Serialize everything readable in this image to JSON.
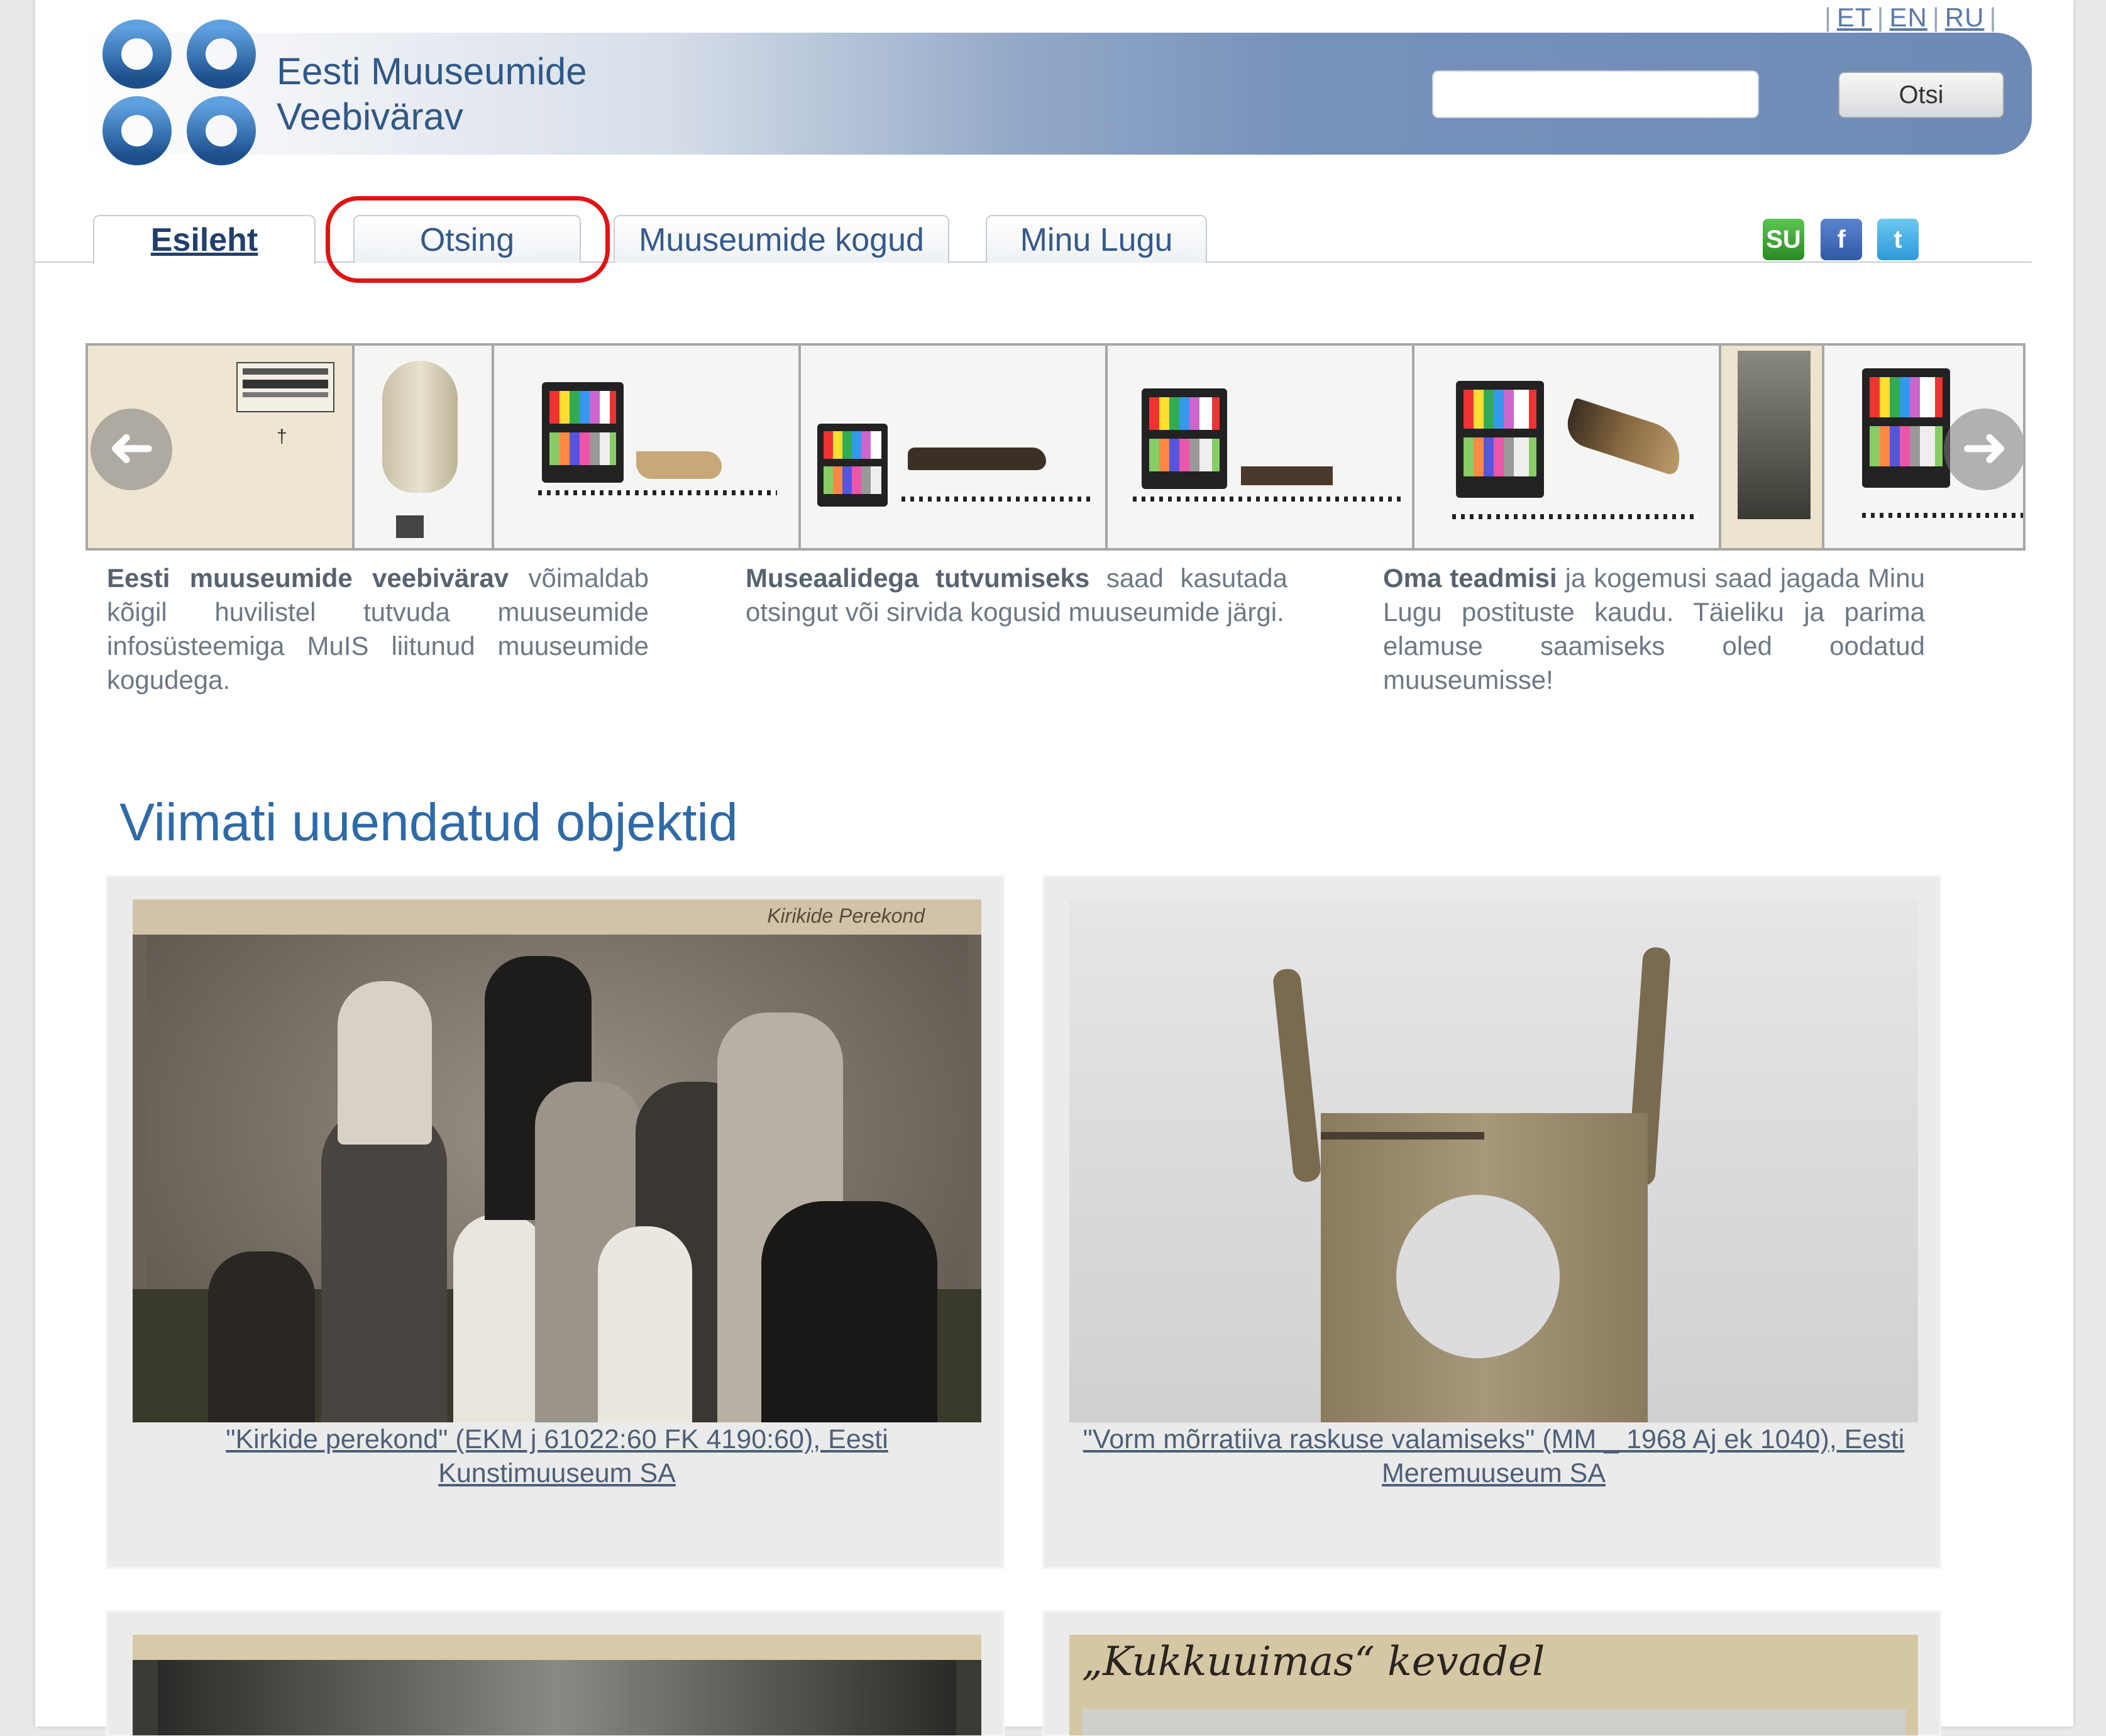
{
  "language_bar": {
    "items": [
      "ET",
      "EN",
      "RU"
    ]
  },
  "header": {
    "site_name_line1": "Eesti Muuseumide",
    "site_name_line2": "Veebivärav",
    "search": {
      "placeholder": "",
      "value": "",
      "button_label": "Otsi"
    }
  },
  "tabs": [
    {
      "label": "Esileht",
      "active": true
    },
    {
      "label": "Otsing",
      "active": false
    },
    {
      "label": "Muuseumide kogud",
      "active": false
    },
    {
      "label": "Minu Lugu",
      "active": false
    }
  ],
  "social": {
    "stumbleupon": "SU",
    "facebook": "f",
    "twitter": "t"
  },
  "carousel": {
    "prev_icon": "arrow-left-icon",
    "next_icon": "arrow-right-icon"
  },
  "intro": [
    {
      "bold": "Eesti muuseumide veebivärav",
      "text": " võimaldab kõigil huvilistel tutvuda muuseumide infosüsteemiga MuIS liitunud muuseumide kogudega."
    },
    {
      "bold": "Museaalidega tutvumiseks",
      "text": " saad kasutada otsingut või sirvida kogusid muuseumide järgi."
    },
    {
      "bold": "Oma teadmisi",
      "text": " ja kogemusi saad jagada Minu Lugu postituste kaudu. Täieliku ja parima elamuse saamiseks oled oodatud muuseumisse!"
    }
  ],
  "recent": {
    "title": "Viimati uuendatud objektid",
    "items": [
      {
        "caption": "\"Kirkide perekond\" (EKM j 61022:60 FK 4190:60), Eesti Kunstimuuseum SA",
        "photo_inscription": "Kirikide Perekond"
      },
      {
        "caption": "\"Vorm mõrratiiva raskuse valamiseks\" (MM _ 1968 Aj ek 1040), Eesti Meremuuseum SA",
        "photo_inscription": ""
      },
      {
        "caption": "",
        "photo_inscription": ""
      },
      {
        "caption": "",
        "photo_inscription": "„Kukkuuimas“ kevadel"
      }
    ]
  },
  "colors": {
    "accent": "#2f6aa8",
    "highlight_ring": "#e01414",
    "header_blue": "#6d8ab6"
  }
}
